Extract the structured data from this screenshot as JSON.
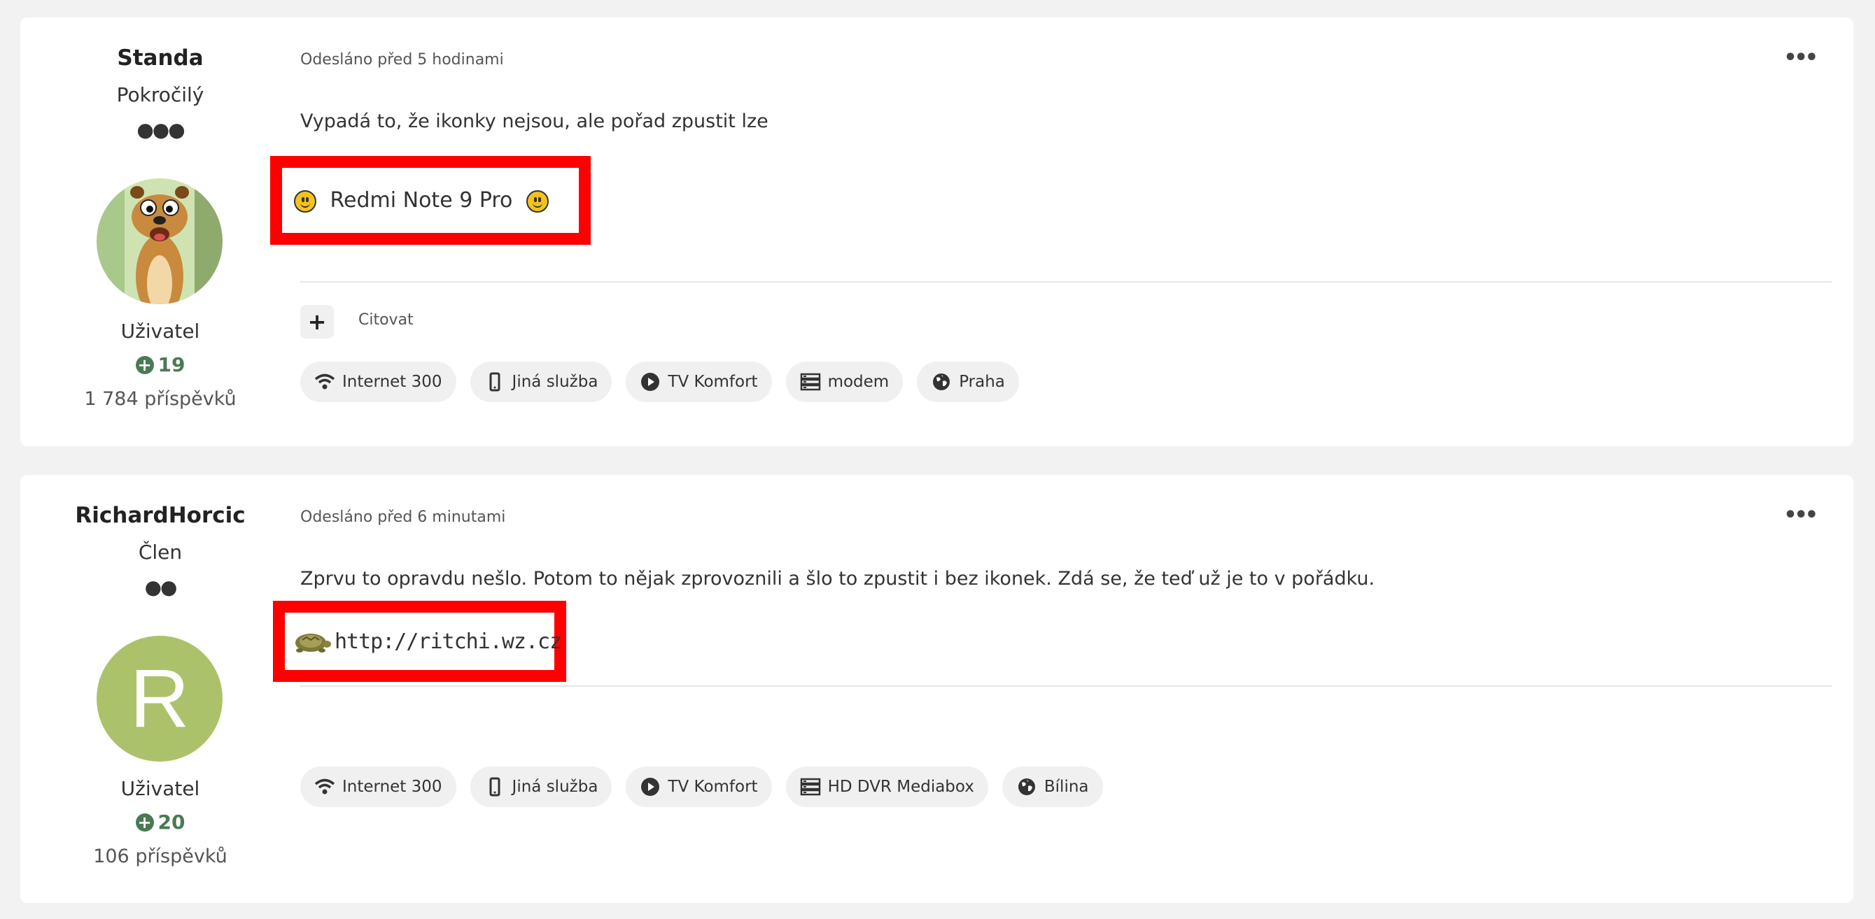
{
  "posts": [
    {
      "author": "Standa",
      "rank": "Pokročilý",
      "rank_dots": "●●●",
      "role": "Uživatel",
      "score": "19",
      "post_count": "1 784 příspěvků",
      "posted": "Odesláno před 5 hodinami",
      "more": "•••",
      "text": "Vypadá to, že ikonky nejsou, ale pořad zpustit lze",
      "signature": "Redmi Note 9 Pro",
      "quote_label": "Citovat",
      "chips": [
        {
          "icon": "wifi-icon",
          "label": "Internet 300"
        },
        {
          "icon": "phone-icon",
          "label": "Jiná služba"
        },
        {
          "icon": "play-icon",
          "label": "TV Komfort"
        },
        {
          "icon": "server-icon",
          "label": "modem"
        },
        {
          "icon": "globe-icon",
          "label": "Praha"
        }
      ]
    },
    {
      "author": "RichardHorcic",
      "rank": "Člen",
      "rank_dots": "●●",
      "avatar_letter": "R",
      "role": "Uživatel",
      "score": "20",
      "post_count": "106 příspěvků",
      "posted": "Odesláno před 6 minutami",
      "more": "•••",
      "text": "Zprvu to opravdu nešlo.  Potom to nějak zprovoznili a šlo to zpustit i bez ikonek.  Zdá se, že teď už je to v pořádku.",
      "signature": "http://ritchi.wz.cz",
      "chips": [
        {
          "icon": "wifi-icon",
          "label": "Internet 300"
        },
        {
          "icon": "phone-icon",
          "label": "Jiná služba"
        },
        {
          "icon": "play-icon",
          "label": "TV Komfort"
        },
        {
          "icon": "server-icon",
          "label": "HD DVR Mediabox"
        },
        {
          "icon": "globe-icon",
          "label": "Bílina"
        }
      ]
    }
  ],
  "colors": {
    "highlight": "#ff0000",
    "score": "#4a7a54",
    "avatar_bg": "#acc26a"
  }
}
